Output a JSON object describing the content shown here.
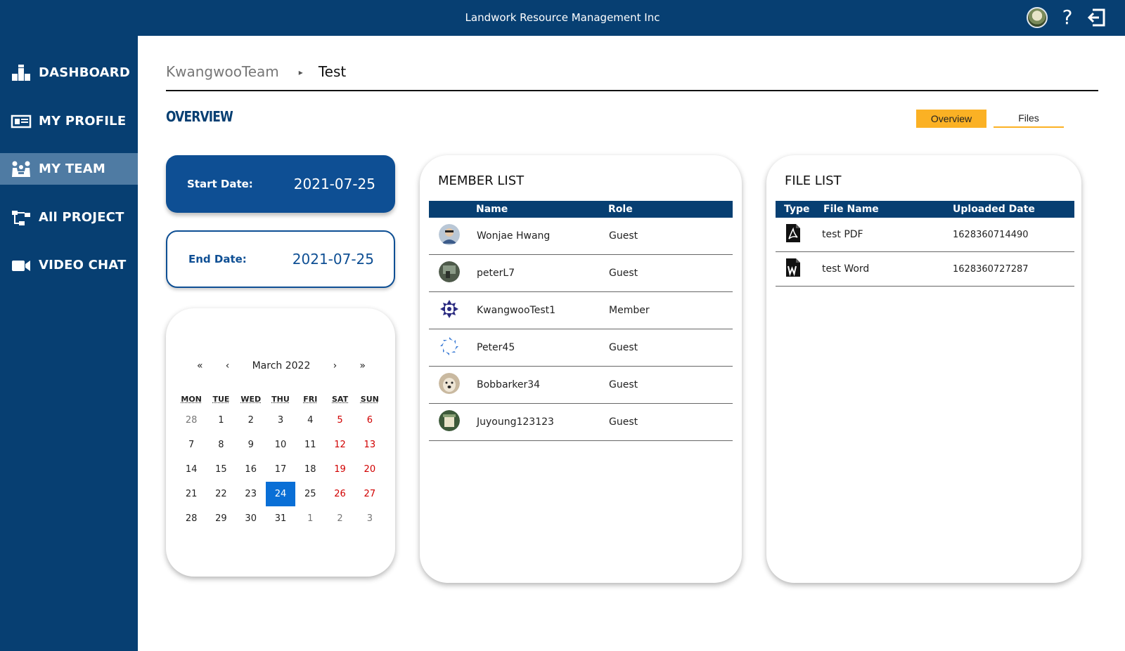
{
  "header": {
    "title": "Landwork Resource Management Inc"
  },
  "sidebar": {
    "items": [
      {
        "label": "DASHBOARD",
        "icon": "dashboard-icon",
        "active": false
      },
      {
        "label": "MY PROFILE",
        "icon": "profile-card-icon",
        "active": false
      },
      {
        "label": "MY TEAM",
        "icon": "team-icon",
        "active": true
      },
      {
        "label": "All PROJECT",
        "icon": "project-tree-icon",
        "active": false
      },
      {
        "label": "VIDEO CHAT",
        "icon": "video-camera-icon",
        "active": false
      }
    ]
  },
  "breadcrumb": {
    "team": "KwangwooTeam",
    "separator": "▸",
    "current": "Test"
  },
  "overview": {
    "title": "OVERVIEW"
  },
  "tabs": {
    "overview": "Overview",
    "files": "Files"
  },
  "dates": {
    "start_label": "Start Date:",
    "start_value": "2021-07-25",
    "end_label": "End Date:",
    "end_value": "2021-07-25"
  },
  "calendar": {
    "prev_year": "«",
    "prev_month": "‹",
    "month": "March 2022",
    "next_month": "›",
    "next_year": "»",
    "weekdays": [
      "MON",
      "TUE",
      "WED",
      "THU",
      "FRI",
      "SAT",
      "SUN"
    ],
    "weeks": [
      [
        "28",
        "1",
        "2",
        "3",
        "4",
        "5",
        "6"
      ],
      [
        "7",
        "8",
        "9",
        "10",
        "11",
        "12",
        "13"
      ],
      [
        "14",
        "15",
        "16",
        "17",
        "18",
        "19",
        "20"
      ],
      [
        "21",
        "22",
        "23",
        "24",
        "25",
        "26",
        "27"
      ],
      [
        "28",
        "29",
        "30",
        "31",
        "1",
        "2",
        "3"
      ]
    ],
    "selected_day": "24"
  },
  "members": {
    "title": "MEMBER LIST",
    "columns": {
      "name": "Name",
      "role": "Role"
    },
    "rows": [
      {
        "name": "Wonjae Hwang",
        "role": "Guest"
      },
      {
        "name": "peterL7",
        "role": "Guest"
      },
      {
        "name": "KwangwooTest1",
        "role": "Member"
      },
      {
        "name": "Peter45",
        "role": "Guest"
      },
      {
        "name": "Bobbarker34",
        "role": "Guest"
      },
      {
        "name": "Juyoung123123",
        "role": "Guest"
      }
    ]
  },
  "files": {
    "title": "FILE LIST",
    "columns": {
      "type": "Type",
      "name": "File Name",
      "date": "Uploaded Date"
    },
    "rows": [
      {
        "type_icon": "pdf-icon",
        "name": "test PDF",
        "date": "1628360714490"
      },
      {
        "type_icon": "word-icon",
        "name": "test Word",
        "date": "1628360727287"
      }
    ]
  },
  "colors": {
    "navy": "#073f72",
    "accent": "#fbb124",
    "selected": "#0a6fd6",
    "weekend": "#d10000"
  }
}
